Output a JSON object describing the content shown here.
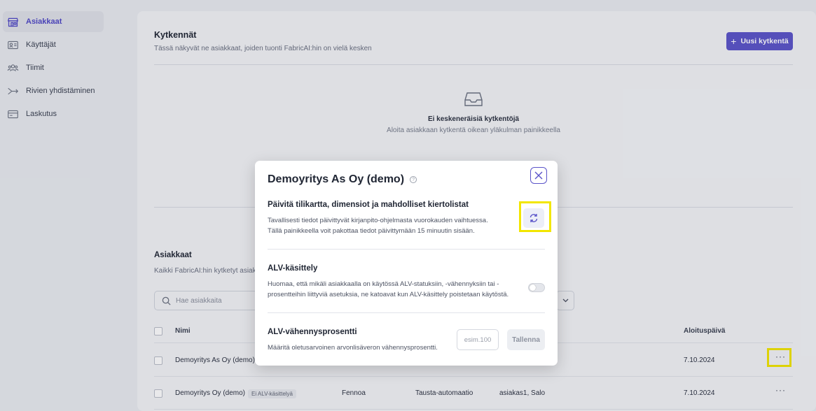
{
  "sidebar": {
    "items": [
      {
        "label": "Asiakkaat",
        "icon": "store-icon",
        "active": true
      },
      {
        "label": "Käyttäjät",
        "icon": "id-card-icon",
        "active": false
      },
      {
        "label": "Tiimit",
        "icon": "users-icon",
        "active": false
      },
      {
        "label": "Rivien yhdistäminen",
        "icon": "merge-arrow-icon",
        "active": false
      },
      {
        "label": "Laskutus",
        "icon": "credit-card-icon",
        "active": false
      }
    ]
  },
  "connections": {
    "title": "Kytkennät",
    "subtitle": "Tässä näkyvät ne asiakkaat, joiden tuonti FabricAI:hin on vielä kesken",
    "new_button": "Uusi kytkentä",
    "empty_title": "Ei keskeneräisiä kytkentöjä",
    "empty_text": "Aloita asiakkaan kytkentä oikean yläkulman painikkeella"
  },
  "customers": {
    "title": "Asiakkaat",
    "subtitle": "Kaikki FabricAI:hin kytketyt asiak",
    "search_placeholder": "Hae asiakkaita",
    "columns": {
      "name": "Nimi",
      "start_date": "Aloituspäivä"
    },
    "rows": [
      {
        "name": "Demoyritys As Oy (demo)",
        "tag": "",
        "system": "",
        "automation": "",
        "team": "",
        "start_date": "7.10.2024"
      },
      {
        "name": "Demoyritys Oy (demo)",
        "tag": "Ei ALV-käsittelyä",
        "system": "Fennoa",
        "automation": "Tausta-automaatio",
        "team": "asiakas1, Salo",
        "start_date": "7.10.2024"
      }
    ]
  },
  "modal": {
    "title": "Demoyritys As Oy (demo)",
    "refresh": {
      "heading": "Päivitä tilikartta, dimensiot ja mahdolliset kiertolistat",
      "text1": "Tavallisesti tiedot päivittyvät kirjanpito-ohjelmasta vuorokauden vaihtuessa.",
      "text2": "Tällä painikkeella voit pakottaa tiedot päivittymään 15 minuutin sisään."
    },
    "vat": {
      "heading": "ALV-käsittely",
      "text1": "Huomaa, että mikäli asiakkaalla on käytössä ALV-statuksiin, -vähennyksiin tai -",
      "text2": "prosentteihin liittyviä asetuksia, ne katoavat kun ALV-käsittely poistetaan käytöstä.",
      "enabled": false
    },
    "vat_pct": {
      "heading": "ALV-vähennysprosentti",
      "text": "Määritä oletusarvoinen arvonlisäveron vähennysprosentti.",
      "placeholder": "esim.100",
      "save": "Tallenna"
    }
  },
  "colors": {
    "accent": "#5b54c9",
    "highlight": "#f2e600"
  }
}
